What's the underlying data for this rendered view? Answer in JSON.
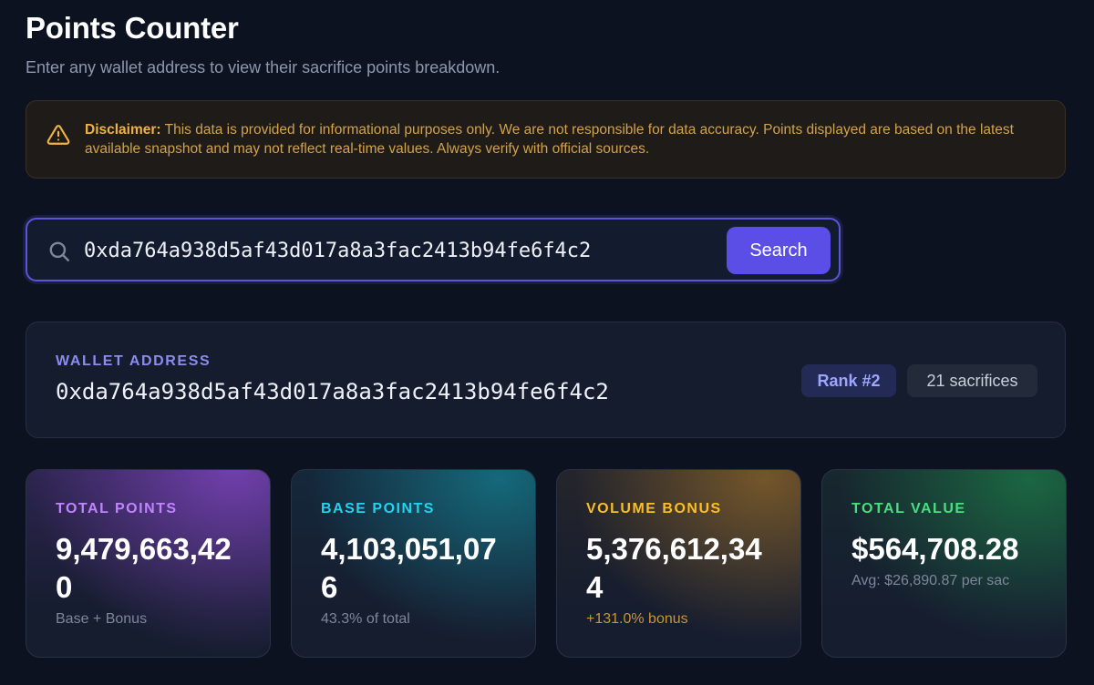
{
  "header": {
    "title": "Points Counter",
    "subtitle": "Enter any wallet address to view their sacrifice points breakdown."
  },
  "disclaimer": {
    "icon": "warning-icon",
    "label": "Disclaimer:",
    "text": "This data is provided for informational purposes only. We are not responsible for data accuracy. Points displayed are based on the latest available snapshot and may not reflect real-time values. Always verify with official sources."
  },
  "search": {
    "icon": "search-icon",
    "value": "0xda764a938d5af43d017a8a3fac2413b94fe6f4c2",
    "button_label": "Search"
  },
  "wallet": {
    "label": "WALLET ADDRESS",
    "address": "0xda764a938d5af43d017a8a3fac2413b94fe6f4c2",
    "rank": "Rank #2",
    "sacrifices": "21 sacrifices"
  },
  "cards": [
    {
      "label": "TOTAL POINTS",
      "value": "9,479,663,420",
      "sub": "Base + Bonus",
      "label_color": "#c084fc",
      "sub_color": "#7d869a"
    },
    {
      "label": "BASE POINTS",
      "value": "4,103,051,076",
      "sub": "43.3% of total",
      "label_color": "#22d3ee",
      "sub_color": "#7d869a"
    },
    {
      "label": "VOLUME BONUS",
      "value": "5,376,612,344",
      "sub": "+131.0% bonus",
      "label_color": "#fbbf24",
      "sub_color": "#c99533"
    },
    {
      "label": "TOTAL VALUE",
      "value": "$564,708.28",
      "sub": "Avg: $26,890.87 per sac",
      "label_color": "#4ade80",
      "sub_color": "#7d869a"
    }
  ],
  "colors": {
    "background": "#0c1220",
    "accent": "#5b4ee6",
    "warning": "#f0b340"
  }
}
